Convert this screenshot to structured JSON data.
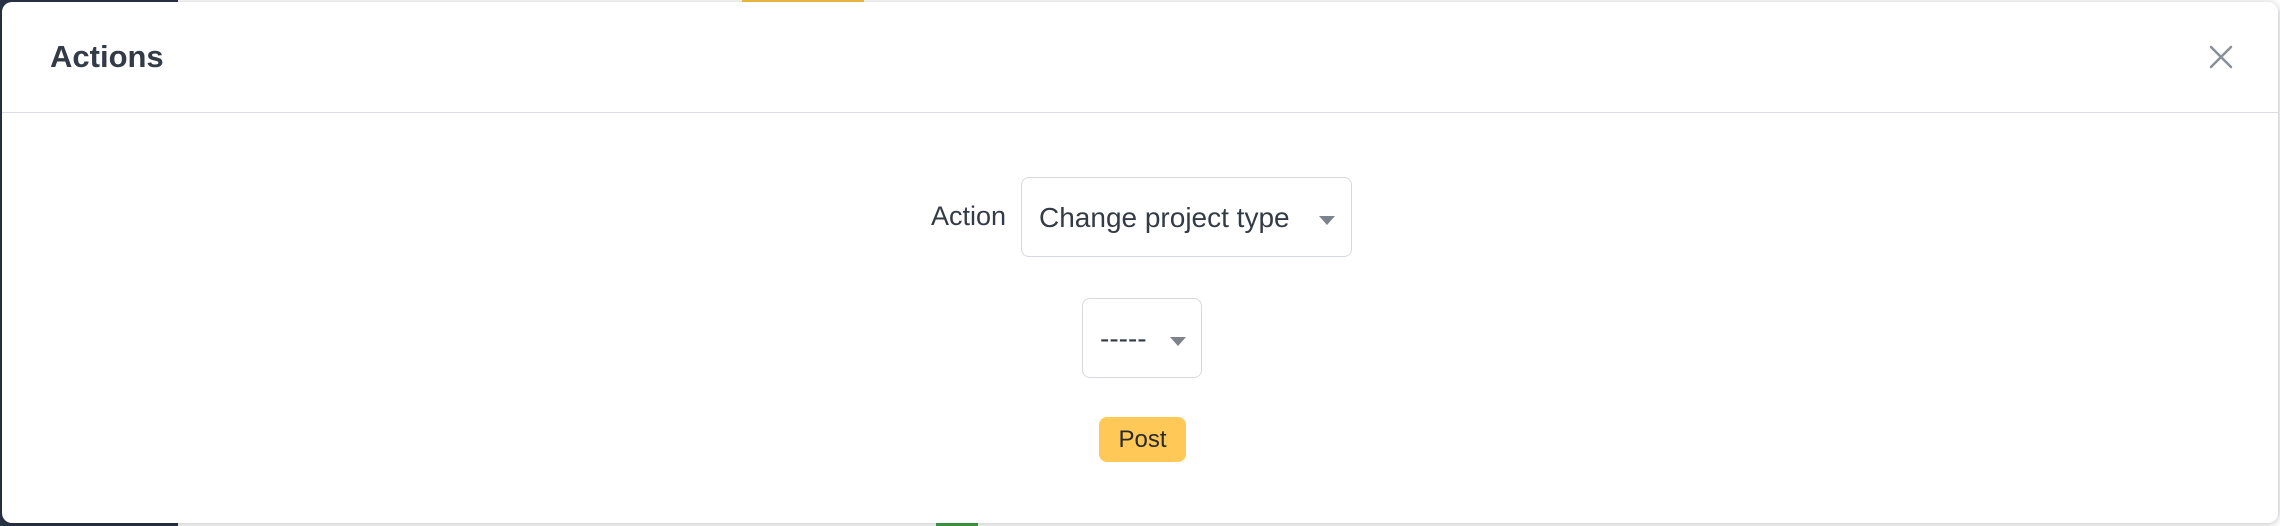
{
  "modal": {
    "title": "Actions",
    "close_icon": "close-icon"
  },
  "form": {
    "action_label": "Action",
    "action_select_value": "Change project type",
    "type_select_value": "-----",
    "submit_label": "Post"
  },
  "colors": {
    "primary_button": "#ffc857",
    "text": "#333b47",
    "border": "#d5d9df"
  }
}
